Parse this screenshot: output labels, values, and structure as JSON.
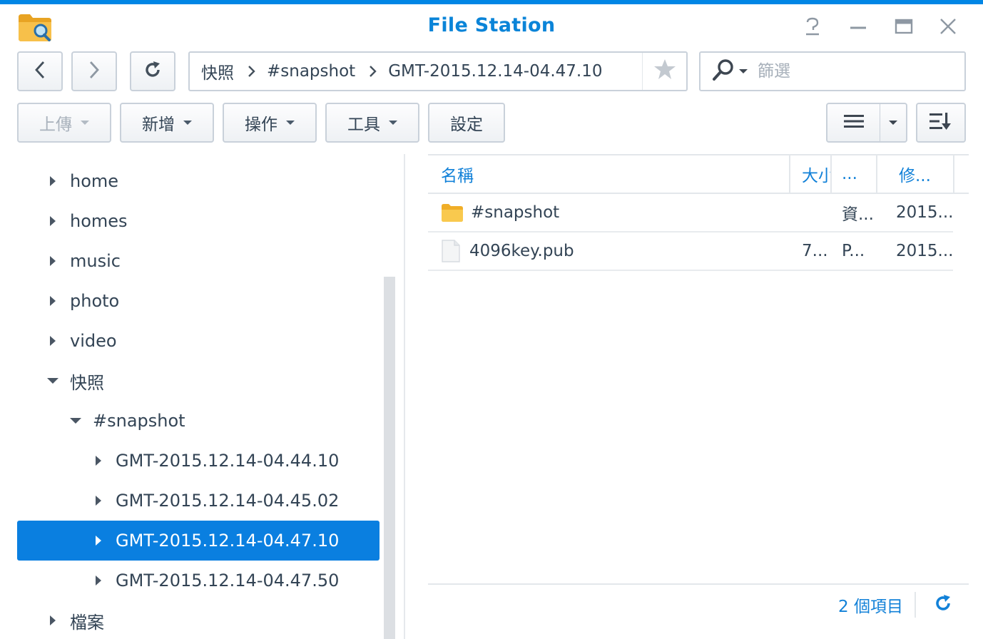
{
  "app": {
    "title": "File Station",
    "accent": "#0086e5"
  },
  "window_controls": [
    "help-icon",
    "minimize-icon",
    "maximize-icon",
    "close-icon"
  ],
  "path": {
    "crumbs": [
      "快照",
      "#snapshot",
      "GMT-2015.12.14-04.47.10"
    ]
  },
  "search": {
    "placeholder": "篩選"
  },
  "toolbar": {
    "upload": "上傳",
    "create": "新增",
    "action": "操作",
    "tools": "工具",
    "settings": "設定"
  },
  "tree": {
    "items": [
      {
        "label": "home",
        "level": 0,
        "expanded": false
      },
      {
        "label": "homes",
        "level": 0,
        "expanded": false
      },
      {
        "label": "music",
        "level": 0,
        "expanded": false
      },
      {
        "label": "photo",
        "level": 0,
        "expanded": false
      },
      {
        "label": "video",
        "level": 0,
        "expanded": false
      },
      {
        "label": "快照",
        "level": 0,
        "expanded": true
      },
      {
        "label": "#snapshot",
        "level": 1,
        "expanded": true
      },
      {
        "label": "GMT-2015.12.14-04.44.10",
        "level": 2,
        "expanded": false
      },
      {
        "label": "GMT-2015.12.14-04.45.02",
        "level": 2,
        "expanded": false
      },
      {
        "label": "GMT-2015.12.14-04.47.10",
        "level": 2,
        "expanded": false,
        "selected": true
      },
      {
        "label": "GMT-2015.12.14-04.47.50",
        "level": 2,
        "expanded": false
      },
      {
        "label": "檔案",
        "level": 0,
        "expanded": false
      }
    ]
  },
  "list": {
    "columns": [
      "名稱",
      "大小",
      "...",
      "修..."
    ],
    "rows": [
      {
        "icon": "folder-icon",
        "name": "#snapshot",
        "size": "",
        "type": "資...",
        "modified": "2015..."
      },
      {
        "icon": "file-icon",
        "name": "4096key.pub",
        "size": "7...",
        "type": "P...",
        "modified": "2015..."
      }
    ]
  },
  "footer": {
    "count": "2 個項目"
  }
}
